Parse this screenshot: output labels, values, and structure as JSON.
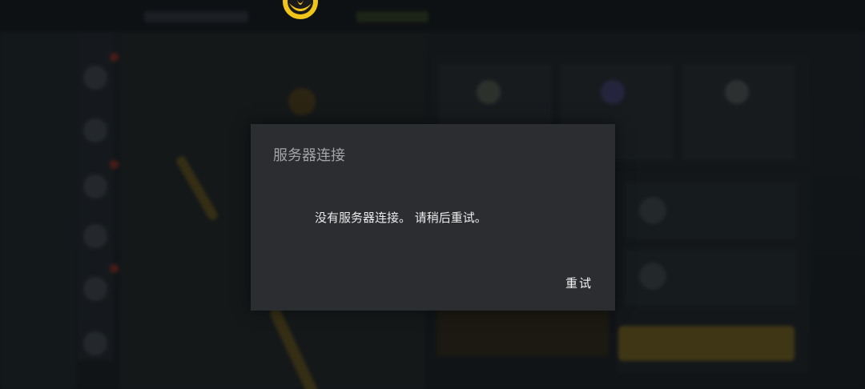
{
  "dialog": {
    "title": "服务器连接",
    "message": "没有服务器连接。 请稍后重试。",
    "retry_label": "重试"
  },
  "colors": {
    "dialog_bg": "#2c2d31",
    "logo": "#f0c419",
    "overlay": "rgba(8,10,12,0.45)"
  },
  "background": {
    "logo_icon": "lotus-logo-icon"
  }
}
